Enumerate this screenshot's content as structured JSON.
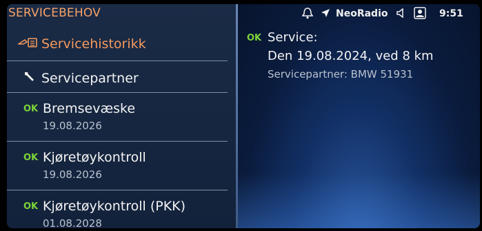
{
  "header": {
    "title": "SERVICEBEHOV"
  },
  "status_bar": {
    "notification_icon": "bell-notification-icon",
    "navigation_icon": "navigation-arrow-icon",
    "source": "NeoRadio",
    "volume_icon": "speaker-icon",
    "phone_icon": "phone-icon",
    "time": "9:51"
  },
  "menu": {
    "items": [
      {
        "label": "Servicehistorikk",
        "icon": "service-history-icon",
        "active": true
      },
      {
        "label": "Servicepartner",
        "icon": "wrench-icon"
      },
      {
        "status": "OK",
        "label": "Bremsevæske",
        "date": "19.08.2026"
      },
      {
        "status": "OK",
        "label": "Kjøretøykontroll",
        "date": "19.08.2026"
      },
      {
        "status": "OK",
        "label": "Kjøretøykontroll (PKK)",
        "date": "01.08.2028"
      }
    ]
  },
  "detail": {
    "status": "OK",
    "title": "Service:",
    "due": "Den 19.08.2024, ved 8 km",
    "partner": "Servicepartner: BMW 51931"
  },
  "colors": {
    "accent_orange": "#f59a5e",
    "ok_green": "#7cd63a",
    "panel_blue": "#13223b"
  }
}
